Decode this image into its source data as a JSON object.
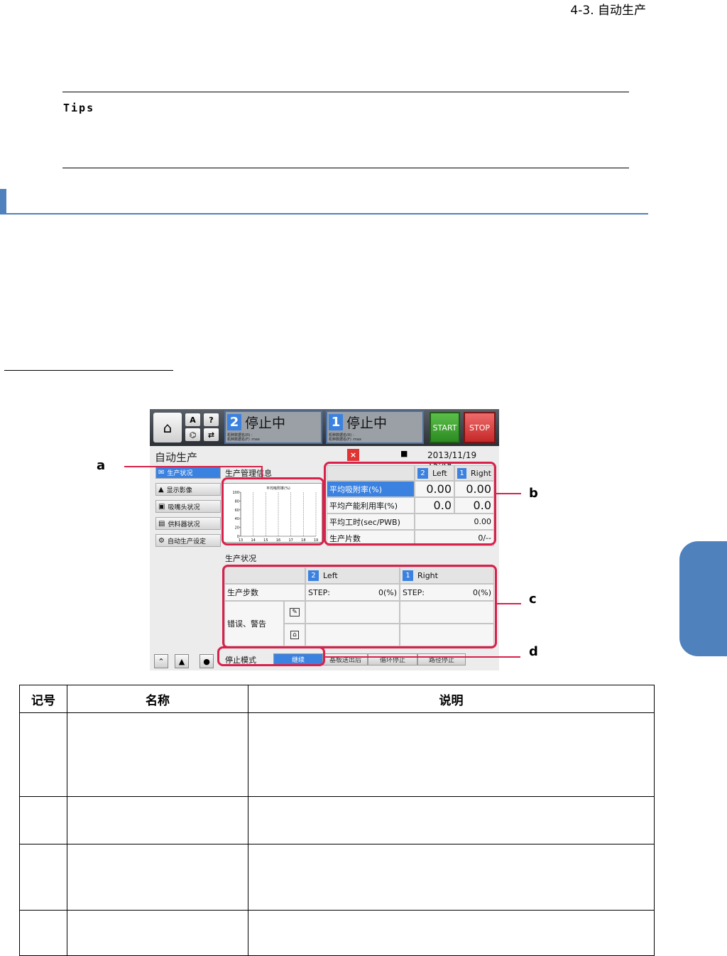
{
  "page": {
    "section_header": "4-3. 自动生产",
    "tips_label": "Tips"
  },
  "screen": {
    "topbar": {
      "btn_a": "A",
      "btn_help": "?",
      "lane2": {
        "num": "2",
        "status": "停止中",
        "info1": "机种数据名(R) :",
        "info2": "机种数据名(F) :max"
      },
      "lane1": {
        "num": "1",
        "status": "停止中",
        "info1": "机种数据名(R) :",
        "info2": "机种数据名(F) :max"
      },
      "start": "START",
      "stop": "STOP"
    },
    "window_title": "自动生产",
    "close": "×",
    "datetime": "2013/11/19 15:48",
    "nav": [
      {
        "label": "生产状况",
        "icon": "mail-icon"
      },
      {
        "label": "显示影像",
        "icon": "person-icon"
      },
      {
        "label": "吸嘴头状况",
        "icon": "nozzle-icon"
      },
      {
        "label": "供料器状况",
        "icon": "feeder-icon"
      },
      {
        "label": "自动生产设定",
        "icon": "settings-icon"
      }
    ],
    "mgmt_label": "生产管理信息",
    "chart_title": "平均吸附率(%)",
    "stats": {
      "head": [
        {
          "num": "2",
          "label": "Left"
        },
        {
          "num": "1",
          "label": "Right"
        }
      ],
      "rows": [
        {
          "label": "平均吸附率(%)",
          "left": "0.00",
          "right": "0.00"
        },
        {
          "label": "平均产能利用率(%)",
          "left": "0.0",
          "right": "0.0"
        },
        {
          "label": "平均工时(sec/PWB)",
          "value": "0.00"
        },
        {
          "label": "生产片数",
          "value": "0/--"
        }
      ]
    },
    "status_label": "生产状况",
    "status": {
      "head": [
        {
          "num": "2",
          "label": "Left"
        },
        {
          "num": "1",
          "label": "Right"
        }
      ],
      "step_label": "生产步数",
      "step_left": "STEP:",
      "step_left_pct": "0(%)",
      "step_right": "STEP:",
      "step_right_pct": "0(%)",
      "error_label": "错误、警告"
    },
    "stop_mode_label": "停止模式",
    "stop_modes": [
      "继续",
      "基板送出后",
      "循环停止",
      "路径停止"
    ],
    "callouts": [
      "a",
      "b",
      "c",
      "d"
    ]
  },
  "chart_data": {
    "type": "line",
    "title": "平均吸附率(%)",
    "x": [
      13,
      14,
      15,
      16,
      17,
      18,
      19
    ],
    "series": [],
    "ylim": [
      0,
      100
    ],
    "yticks": [
      0,
      20,
      40,
      60,
      80,
      100
    ],
    "xticks": [
      "13",
      "14",
      "15",
      "16",
      "17",
      "18",
      "19"
    ],
    "grid": true
  },
  "table": {
    "headers": [
      "记号",
      "名称",
      "说明"
    ],
    "rows": [
      [
        "",
        "",
        ""
      ],
      [
        "",
        "",
        ""
      ],
      [
        "",
        "",
        ""
      ],
      [
        "",
        "",
        ""
      ]
    ]
  }
}
